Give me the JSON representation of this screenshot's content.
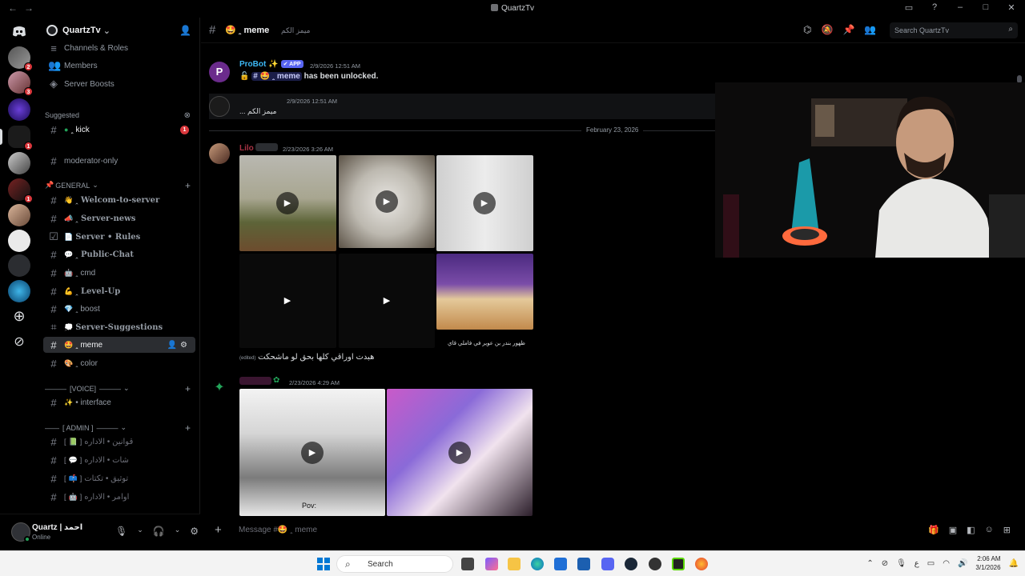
{
  "window": {
    "title": "QuartzTv",
    "nav_back": "←",
    "nav_forward": "→"
  },
  "server": {
    "name": "QuartzTv",
    "menu": {
      "channels_roles": "Channels & Roles",
      "members": "Members",
      "server_boosts": "Server Boosts"
    },
    "suggested_label": "Suggested",
    "suggested_channel": "ꞈ kick",
    "suggested_badge": "1",
    "moderator_channel": "moderator-only"
  },
  "rail": {
    "pings": [
      "2",
      "3",
      "1",
      "1"
    ]
  },
  "categories": {
    "general": "GENERAL",
    "voice": "[VOICE]",
    "admin": "[ ADMIN ]"
  },
  "channels": {
    "welcome": "ꞈ Welcom-to-server",
    "news": "ꞈ Server-news",
    "rules": "Server • Rules",
    "public_chat": "ꞈ Public-Chat",
    "cmd": "ꞈ cmd",
    "level_up": "ꞈ Level-Up",
    "boost": "ꞈ boost",
    "suggestions": "Server-Suggestions",
    "meme": "ꞈ meme",
    "color": "ꞈ color",
    "interface": "• interface",
    "admin1": "قوانين • الاداره",
    "admin2": "شات • الاداره",
    "admin3": "توثيق • تكتات",
    "admin4": "اوامر • الاداره"
  },
  "user": {
    "name": "Quartz | احمد",
    "status": "Online"
  },
  "header": {
    "channel": "ꞈ meme",
    "topic": "ميمز الكم",
    "search_placeholder": "Search QuartzTv"
  },
  "messages": {
    "probot_name": "ProBot",
    "probot_tag": "APP",
    "probot_time": "2/9/2026 12:51 AM",
    "probot_channel": "ꞈ meme",
    "probot_text": "has been unlocked.",
    "quartz_time": "2/9/2026 12:51 AM",
    "quartz_text": "... ميمز الكم",
    "date_separator": "February 23, 2026",
    "lilo_name": "Lilo",
    "lilo_time": "2/23/2026 3:26 AM",
    "lilo_caption": "ظهور بندر بن عوير في فاملي قاي",
    "lilo_edited": "(edited)",
    "lilo_text": "هبدت اوراقي كلها بحق لو ماشحكت",
    "third_time": "2/23/2026 4:29 AM",
    "video_caption": "Pov:"
  },
  "composer": {
    "placeholder": "Message #🤩 ꞈ meme"
  },
  "taskbar": {
    "search": "Search",
    "time": "2:06 AM",
    "date": "3/1/2026",
    "lang": "ع"
  }
}
